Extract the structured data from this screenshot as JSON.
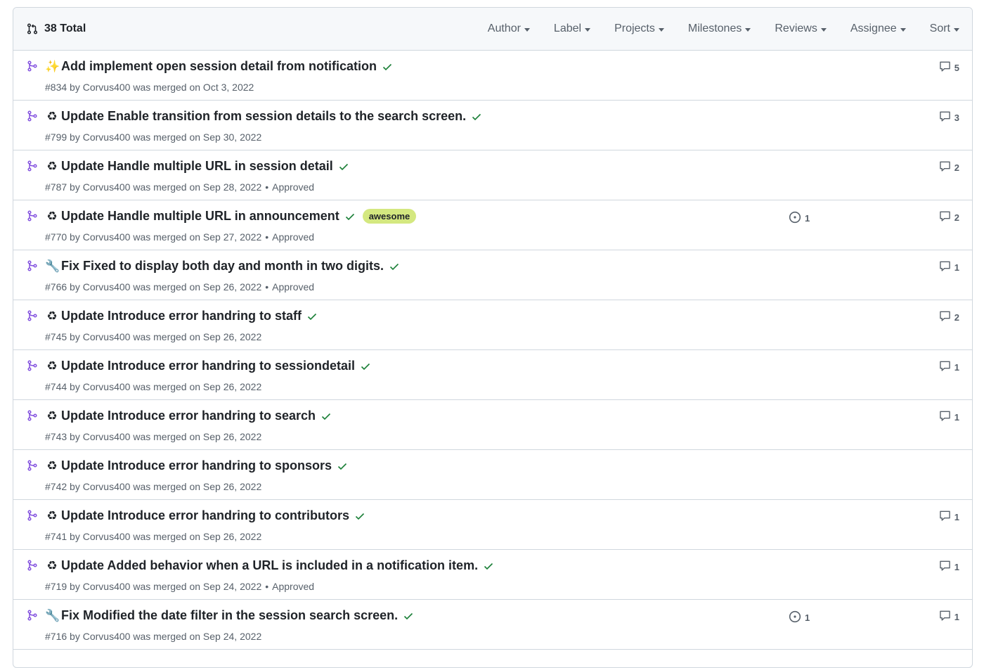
{
  "header": {
    "total": "38 Total",
    "filters": [
      "Author",
      "Label",
      "Projects",
      "Milestones",
      "Reviews",
      "Assignee",
      "Sort"
    ]
  },
  "colors": {
    "merged_icon": "#8250df",
    "check": "#1a7f37",
    "label_awesome_bg": "#d4e880"
  },
  "pull_requests": [
    {
      "emoji": "✨",
      "emoji_name": "sparkles-icon",
      "title": "Add implement open session detail from notification",
      "number": "#834",
      "author": "Corvus400",
      "merged_text": "was merged on Oct 3, 2022",
      "review": "",
      "label": "",
      "linked_issues": "",
      "comments": "5"
    },
    {
      "emoji": "♻",
      "emoji_name": "recycle-icon",
      "title": "Update Enable transition from session details to the search screen.",
      "number": "#799",
      "author": "Corvus400",
      "merged_text": "was merged on Sep 30, 2022",
      "review": "",
      "label": "",
      "linked_issues": "",
      "comments": "3"
    },
    {
      "emoji": "♻",
      "emoji_name": "recycle-icon",
      "title": "Update Handle multiple URL in session detail",
      "number": "#787",
      "author": "Corvus400",
      "merged_text": "was merged on Sep 28, 2022",
      "review": "Approved",
      "label": "",
      "linked_issues": "",
      "comments": "2"
    },
    {
      "emoji": "♻",
      "emoji_name": "recycle-icon",
      "title": "Update Handle multiple URL in announcement",
      "number": "#770",
      "author": "Corvus400",
      "merged_text": "was merged on Sep 27, 2022",
      "review": "Approved",
      "label": "awesome",
      "linked_issues": "1",
      "comments": "2"
    },
    {
      "emoji": "🔧",
      "emoji_name": "wrench-icon",
      "title": "Fix Fixed to display both day and month in two digits.",
      "number": "#766",
      "author": "Corvus400",
      "merged_text": "was merged on Sep 26, 2022",
      "review": "Approved",
      "label": "",
      "linked_issues": "",
      "comments": "1"
    },
    {
      "emoji": "♻",
      "emoji_name": "recycle-icon",
      "title": "Update Introduce error handring to staff",
      "number": "#745",
      "author": "Corvus400",
      "merged_text": "was merged on Sep 26, 2022",
      "review": "",
      "label": "",
      "linked_issues": "",
      "comments": "2"
    },
    {
      "emoji": "♻",
      "emoji_name": "recycle-icon",
      "title": "Update Introduce error handring to sessiondetail",
      "number": "#744",
      "author": "Corvus400",
      "merged_text": "was merged on Sep 26, 2022",
      "review": "",
      "label": "",
      "linked_issues": "",
      "comments": "1"
    },
    {
      "emoji": "♻",
      "emoji_name": "recycle-icon",
      "title": "Update Introduce error handring to search",
      "number": "#743",
      "author": "Corvus400",
      "merged_text": "was merged on Sep 26, 2022",
      "review": "",
      "label": "",
      "linked_issues": "",
      "comments": "1"
    },
    {
      "emoji": "♻",
      "emoji_name": "recycle-icon",
      "title": "Update Introduce error handring to sponsors",
      "number": "#742",
      "author": "Corvus400",
      "merged_text": "was merged on Sep 26, 2022",
      "review": "",
      "label": "",
      "linked_issues": "",
      "comments": ""
    },
    {
      "emoji": "♻",
      "emoji_name": "recycle-icon",
      "title": "Update Introduce error handring to contributors",
      "number": "#741",
      "author": "Corvus400",
      "merged_text": "was merged on Sep 26, 2022",
      "review": "",
      "label": "",
      "linked_issues": "",
      "comments": "1"
    },
    {
      "emoji": "♻",
      "emoji_name": "recycle-icon",
      "title": "Update Added behavior when a URL is included in a notification item.",
      "number": "#719",
      "author": "Corvus400",
      "merged_text": "was merged on Sep 24, 2022",
      "review": "Approved",
      "label": "",
      "linked_issues": "",
      "comments": "1"
    },
    {
      "emoji": "🔧",
      "emoji_name": "wrench-icon",
      "title": "Fix Modified the date filter in the session search screen.",
      "number": "#716",
      "author": "Corvus400",
      "merged_text": "was merged on Sep 24, 2022",
      "review": "",
      "label": "",
      "linked_issues": "1",
      "comments": "1"
    }
  ]
}
